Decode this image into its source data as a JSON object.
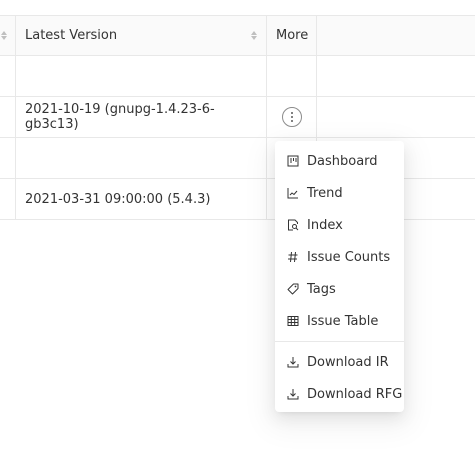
{
  "table": {
    "columns": {
      "latest_version": "Latest Version",
      "more": "More"
    },
    "rows": [
      {
        "latest_version": "",
        "has_more_button": false
      },
      {
        "latest_version": "2021-10-19 (gnupg-1.4.23-6-gb3c13)",
        "has_more_button": true
      },
      {
        "latest_version": "",
        "has_more_button": false
      },
      {
        "latest_version": "2021-03-31 09:00:00 (5.4.3)",
        "has_more_button": false
      }
    ]
  },
  "menu": {
    "items": [
      {
        "label": "Dashboard",
        "icon": "dashboard-icon"
      },
      {
        "label": "Trend",
        "icon": "line-chart-icon"
      },
      {
        "label": "Index",
        "icon": "file-search-icon"
      },
      {
        "label": "Issue Counts",
        "icon": "number-icon"
      },
      {
        "label": "Tags",
        "icon": "tag-icon"
      },
      {
        "label": "Issue Table",
        "icon": "table-icon"
      }
    ],
    "downloads": [
      {
        "label": "Download IR",
        "icon": "download-icon"
      },
      {
        "label": "Download RFG",
        "icon": "download-icon"
      }
    ]
  }
}
